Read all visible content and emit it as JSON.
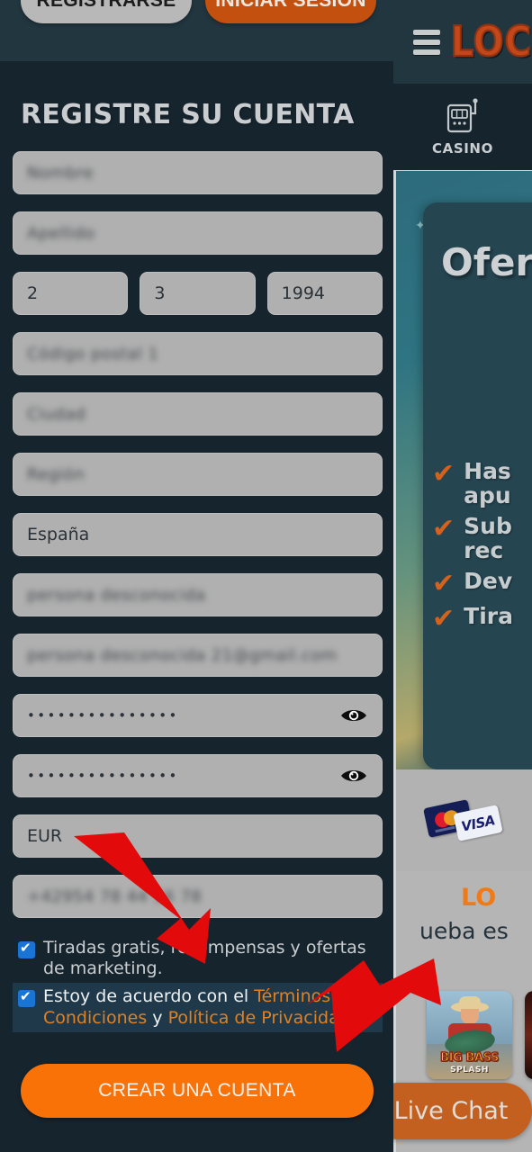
{
  "modal": {
    "tabs": {
      "register_label": "REGISTRARSE",
      "login_label": "INICIAR SESIÓN"
    },
    "title": "REGISTRE SU CUENTA",
    "fields": [
      {
        "name": "first-name",
        "value": "Nombre",
        "blurred": true
      },
      {
        "name": "last-name",
        "value": "Apellido",
        "blurred": true
      }
    ],
    "dob": {
      "day": "2",
      "month": "3",
      "year": "1994"
    },
    "fields2": [
      {
        "name": "street-address",
        "value": "Código postal 1",
        "blurred": true
      },
      {
        "name": "city",
        "value": "Ciudad",
        "blurred": true
      },
      {
        "name": "region",
        "value": "Región",
        "blurred": true
      }
    ],
    "country": "España",
    "fields3": [
      {
        "name": "username",
        "value": "persona desconocida",
        "blurred": true
      },
      {
        "name": "email",
        "value": "persona desconocida 21@gmail.com",
        "blurred": true
      }
    ],
    "password": "•••••••••••••••",
    "password_confirm": "•••••••••••••••",
    "currency": "EUR",
    "phone": {
      "value": "+42954 78 44 56 78",
      "blurred": true
    },
    "consents": [
      {
        "name": "marketing-consent",
        "checked": true,
        "text": "Tiradas gratis, recompensas y ofertas de marketing.",
        "highlighted": false
      }
    ],
    "terms_consent": {
      "name": "terms-consent",
      "checked": true,
      "prefix": "Estoy de acuerdo con el ",
      "link1": "Términos y Condiciones",
      "middle": " y ",
      "link2": "Política de Privacidad",
      "highlighted": true
    },
    "submit_label": "CREAR UNA CUENTA"
  },
  "background": {
    "brand": "LOC",
    "nav": {
      "casino_label": "CASINO",
      "casino_icon": "slot-machine-icon",
      "menu_icon": "hamburger-menu-icon"
    },
    "promo": {
      "title": "Ofer",
      "benefits": [
        "Has",
        "apu",
        "Sub",
        "rec",
        "Dev",
        "Tira"
      ],
      "benefit_lines": [
        {
          "check": "✔",
          "lines": [
            "Has",
            "apu"
          ]
        },
        {
          "check": "✔",
          "lines": [
            "Sub",
            "rec"
          ]
        },
        {
          "check": "✔",
          "lines": [
            "Dev"
          ]
        },
        {
          "check": "✔",
          "lines": [
            "Tira"
          ]
        }
      ]
    },
    "payments": {
      "visa_label": "VISA",
      "mastercard_icon": "mastercard-icon"
    },
    "promo2": {
      "title": "LO",
      "subtitle": "ueba es"
    },
    "games": [
      {
        "name": "big-bass-splash",
        "title": "BIG BASS",
        "subtitle": "SPLASH"
      },
      {
        "name": "game-tile-2",
        "title": "",
        "subtitle": ""
      }
    ],
    "live_chat_label": "Live Chat"
  },
  "annotations": {
    "arrow_color": "#e20a0a",
    "arrows": [
      {
        "name": "arrow-to-consent-checkbox"
      },
      {
        "name": "arrow-to-terms-checkbox"
      }
    ]
  },
  "colors": {
    "modal_bg": "#16242e",
    "topbar_bg": "#223640",
    "field_bg": "#b0b0b0",
    "accent_orange": "#f87208",
    "link_orange": "#e08020",
    "checkbox_blue": "#1a74d4",
    "highlight_row": "#20394a"
  }
}
